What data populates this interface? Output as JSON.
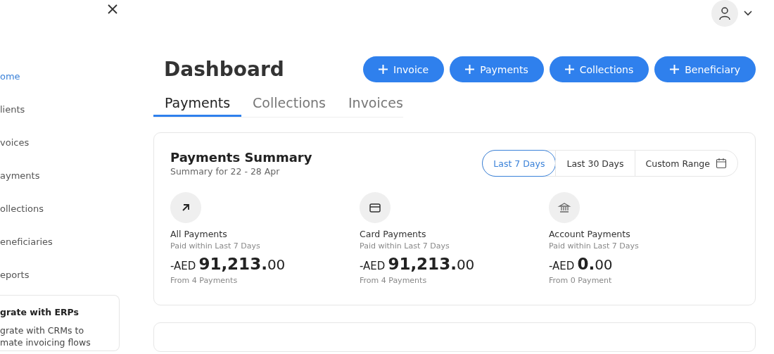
{
  "sidebar": {
    "items": [
      {
        "label": "ome",
        "selected": true
      },
      {
        "label": "lients",
        "selected": false
      },
      {
        "label": "voices",
        "selected": false
      },
      {
        "label": "ayments",
        "selected": false
      },
      {
        "label": "ollections",
        "selected": false
      },
      {
        "label": "eneficiaries",
        "selected": false
      },
      {
        "label": "eports",
        "selected": false
      }
    ],
    "promo": {
      "title": "grate with ERPs",
      "text": "grate with CRMs to mate invoicing flows"
    }
  },
  "header": {
    "title": "Dashboard",
    "actions": [
      "Invoice",
      "Payments",
      "Collections",
      "Beneficiary"
    ]
  },
  "tabs": [
    {
      "label": "Payments",
      "selected": true
    },
    {
      "label": "Collections",
      "selected": false
    },
    {
      "label": "Invoices",
      "selected": false
    }
  ],
  "summary": {
    "title": "Payments Summary",
    "subtitle": "Summary for 22 - 28 Apr",
    "ranges": [
      {
        "label": "Last 7 Days",
        "selected": true,
        "kind": "plain"
      },
      {
        "label": "Last 30 Days",
        "selected": false,
        "kind": "plain"
      },
      {
        "label": "Custom Range",
        "selected": false,
        "kind": "calendar"
      }
    ],
    "metrics": [
      {
        "kind": "arrow",
        "title": "All Payments",
        "caption": "Paid within Last 7 Days",
        "prefix": "-AED",
        "whole": "91,213.",
        "decimals": "00",
        "footnote": "From 4 Payments"
      },
      {
        "kind": "card",
        "title": "Card Payments",
        "caption": "Paid within Last 7 Days",
        "prefix": "-AED",
        "whole": "91,213.",
        "decimals": "00",
        "footnote": "From 4 Payments"
      },
      {
        "kind": "bank",
        "title": "Account Payments",
        "caption": "Paid within Last 7 Days",
        "prefix": "-AED",
        "whole": "0.",
        "decimals": "00",
        "footnote": "From 0 Payment"
      }
    ]
  }
}
